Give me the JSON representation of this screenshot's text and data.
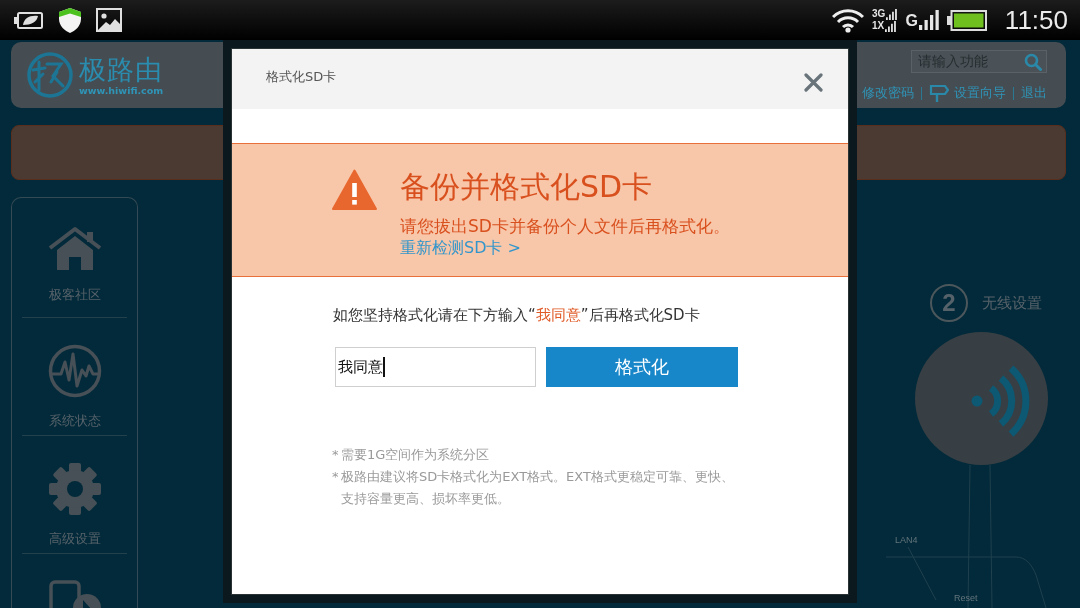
{
  "status_bar": {
    "signals": [
      {
        "kind": "dual",
        "labels": [
          "3G",
          "1X"
        ]
      },
      {
        "kind": "single",
        "labels": [
          "G"
        ]
      }
    ],
    "time": "11:50"
  },
  "header": {
    "logo": {
      "name": "极路由",
      "url": "www.hiwifi.com"
    },
    "search": {
      "placeholder": "请输入功能"
    },
    "links": [
      {
        "label": "修改密码",
        "kind": "text"
      },
      {
        "label": "设置向导",
        "kind": "icon"
      },
      {
        "label": "退出",
        "kind": "text"
      }
    ]
  },
  "sidebar": {
    "items": [
      {
        "label": "极客社区"
      },
      {
        "label": "系统状态"
      },
      {
        "label": "高级设置"
      }
    ]
  },
  "wizard": {
    "step": {
      "number": "2",
      "label": "无线设置"
    },
    "ports": [
      {
        "label": "LAN4"
      },
      {
        "label": "Reset"
      }
    ]
  },
  "dialog": {
    "title": "格式化SD卡",
    "warning": {
      "title": "备份并格式化SD卡",
      "message": "请您拔出SD卡并备份个人文件后再格式化。",
      "link": "重新检测SD卡 >"
    },
    "prompt": [
      {
        "text": "如您坚持格式化请在下方输入“",
        "highlight": false
      },
      {
        "text": "我同意",
        "highlight": true
      },
      {
        "text": "”后再格式化SD卡",
        "highlight": false
      }
    ],
    "input": {
      "value": "我同意",
      "focused": true
    },
    "button": "格式化",
    "notes": [
      {
        "marker": "*",
        "text": "需要1G空间作为系统分区"
      },
      {
        "marker": "*",
        "text": "极路由建议将SD卡格式化为EXT格式。EXT格式更稳定可靠、更快、支持容量更高、损坏率更低。"
      }
    ]
  }
}
